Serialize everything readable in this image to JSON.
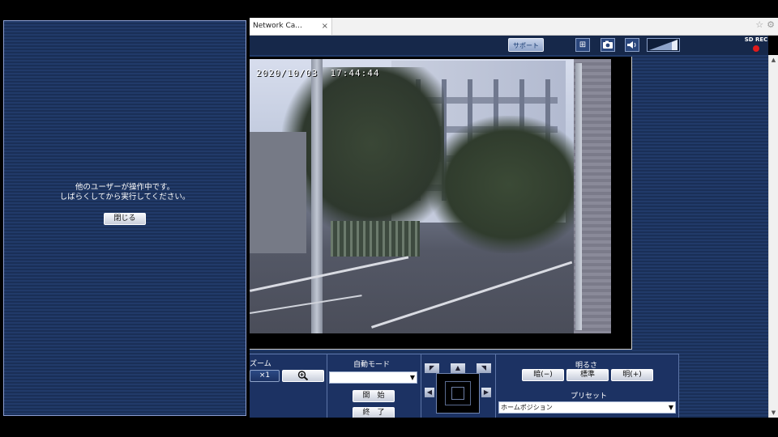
{
  "browser": {
    "tab_title": "Network Ca...",
    "tab_close": "×",
    "icons": [
      "star-icon",
      "gear-icon"
    ]
  },
  "camera": {
    "toolbar": {
      "support_label": "サポート",
      "sd_rec_label": "SD REC",
      "icons": [
        "fit-window-icon",
        "snapshot-camera-icon",
        "speaker-icon",
        "volume-bars-icon"
      ]
    },
    "osd": {
      "date": "2020/10/03",
      "time": "17:44:44"
    },
    "controls": {
      "zoom": {
        "label": "ズーム",
        "x1_label": "×1",
        "zoom_in_icon": "zoom-in-icon"
      },
      "auto_mode": {
        "label": "自動モード",
        "selected": "",
        "start_label": "開　始",
        "end_label": "終　了"
      },
      "brightness": {
        "label": "明るさ",
        "dark_label": "暗(−)",
        "standard_label": "標準",
        "bright_label": "明(+)"
      },
      "preset": {
        "label": "プリセット",
        "selected": "ホームポジション"
      }
    }
  },
  "popup": {
    "line1": "他のユーザーが操作中です。",
    "line2": "しばらくしてから実行してください。",
    "close_label": "閉じる"
  }
}
